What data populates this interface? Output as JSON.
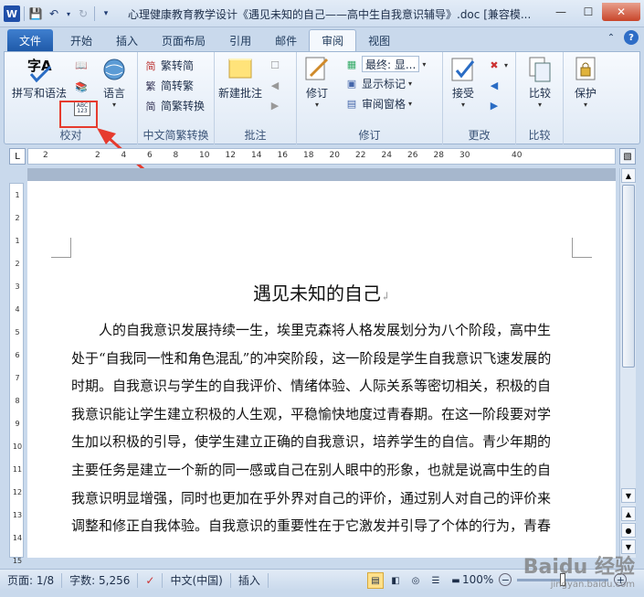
{
  "window": {
    "title": "心理健康教育教学设计《遇见未知的自己——高中生自我意识辅导》.doc [兼容模..."
  },
  "qat": {
    "app_icon": "W"
  },
  "tabs": [
    {
      "label": "文件"
    },
    {
      "label": "开始"
    },
    {
      "label": "插入"
    },
    {
      "label": "页面布局"
    },
    {
      "label": "引用"
    },
    {
      "label": "邮件"
    },
    {
      "label": "审阅"
    },
    {
      "label": "视图"
    }
  ],
  "ribbon": {
    "proofing": {
      "spelling": "拼写和语法",
      "language": "语言",
      "group": "校对",
      "wordcount_icon": "ABC\n123"
    },
    "chinese": {
      "trad_to_simp": "繁转简",
      "simp_to_trad": "简转繁",
      "convert": "简繁转换",
      "group": "中文简繁转换"
    },
    "comments": {
      "new": "新建批注",
      "group": "批注"
    },
    "tracking": {
      "track": "修订",
      "final": "最终: 显...",
      "show_markup": "显示标记",
      "pane": "审阅窗格",
      "group": "修订"
    },
    "changes": {
      "accept": "接受",
      "group": "更改"
    },
    "compare": {
      "compare": "比较",
      "group": "比较"
    },
    "protect": {
      "protect": "保护"
    }
  },
  "ruler": {
    "h_numbers": [
      "2",
      "",
      "2",
      "4",
      "6",
      "8",
      "10",
      "12",
      "14",
      "16",
      "18",
      "20",
      "22",
      "24",
      "26",
      "28",
      "30",
      "",
      "40"
    ],
    "v_numbers": [
      "1",
      "2",
      "1",
      "2",
      "3",
      "4",
      "5",
      "6",
      "7",
      "8",
      "9",
      "10",
      "11",
      "12",
      "13",
      "14",
      "15"
    ]
  },
  "document": {
    "title": "遇见未知的自己",
    "lines": [
      "　　人的自我意识发展持续一生，埃里克森将人格发展划分为八个阶段，高中生",
      "处于“自我同一性和角色混乱”的冲突阶段，这一阶段是学生自我意识飞速发展的",
      "时期。自我意识与学生的自我评价、情绪体验、人际关系等密切相关，积极的自",
      "我意识能让学生建立积极的人生观，平稳愉快地度过青春期。在这一阶段要对学",
      "生加以积极的引导，使学生建立正确的自我意识，培养学生的自信。青少年期的",
      "主要任务是建立一个新的同一感或自己在别人眼中的形象，也就是说高中生的自",
      "我意识明显增强，同时也更加在乎外界对自己的评价，通过别人对自己的评价来",
      "调整和修正自我体验。自我意识的重要性在于它激发并引导了个体的行为，青春"
    ]
  },
  "status": {
    "page": "页面: 1/8",
    "words": "字数: 5,256",
    "lang": "中文(中国)",
    "mode": "插入",
    "zoom": "100%"
  },
  "watermark": {
    "brand": "Baidu 经验",
    "url": "jingyan.baidu.com"
  },
  "colors": {
    "accent": "#1f5aa9",
    "highlight": "#e63b2e"
  }
}
